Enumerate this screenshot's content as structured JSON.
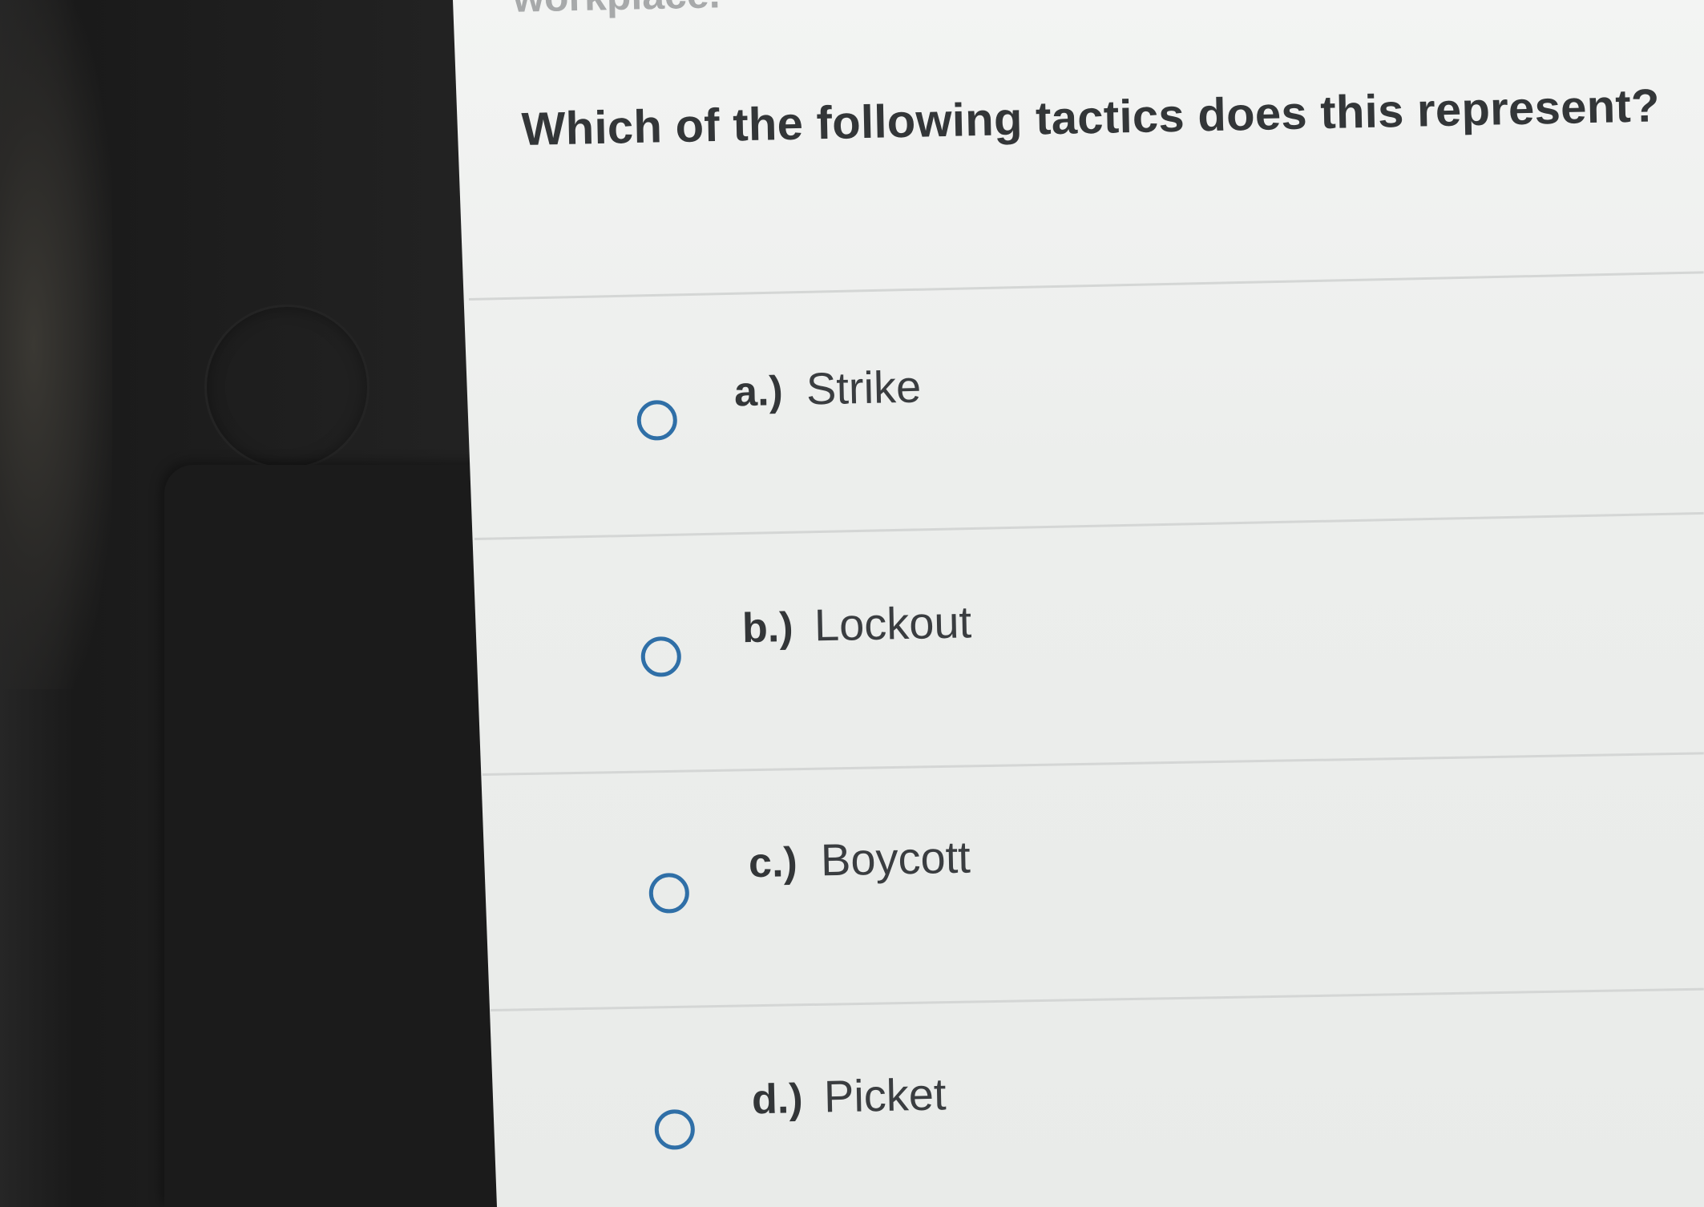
{
  "question": {
    "cutoff_text": "workplace.",
    "prompt": "Which of the following tactics does this represent?"
  },
  "options": [
    {
      "letter": "a.)",
      "text": "Strike"
    },
    {
      "letter": "b.)",
      "text": "Lockout"
    },
    {
      "letter": "c.)",
      "text": "Boycott"
    },
    {
      "letter": "d.)",
      "text": "Picket"
    }
  ],
  "colors": {
    "radio_border": "#2f6fa7",
    "text": "#333638",
    "background": "#eceeec"
  }
}
